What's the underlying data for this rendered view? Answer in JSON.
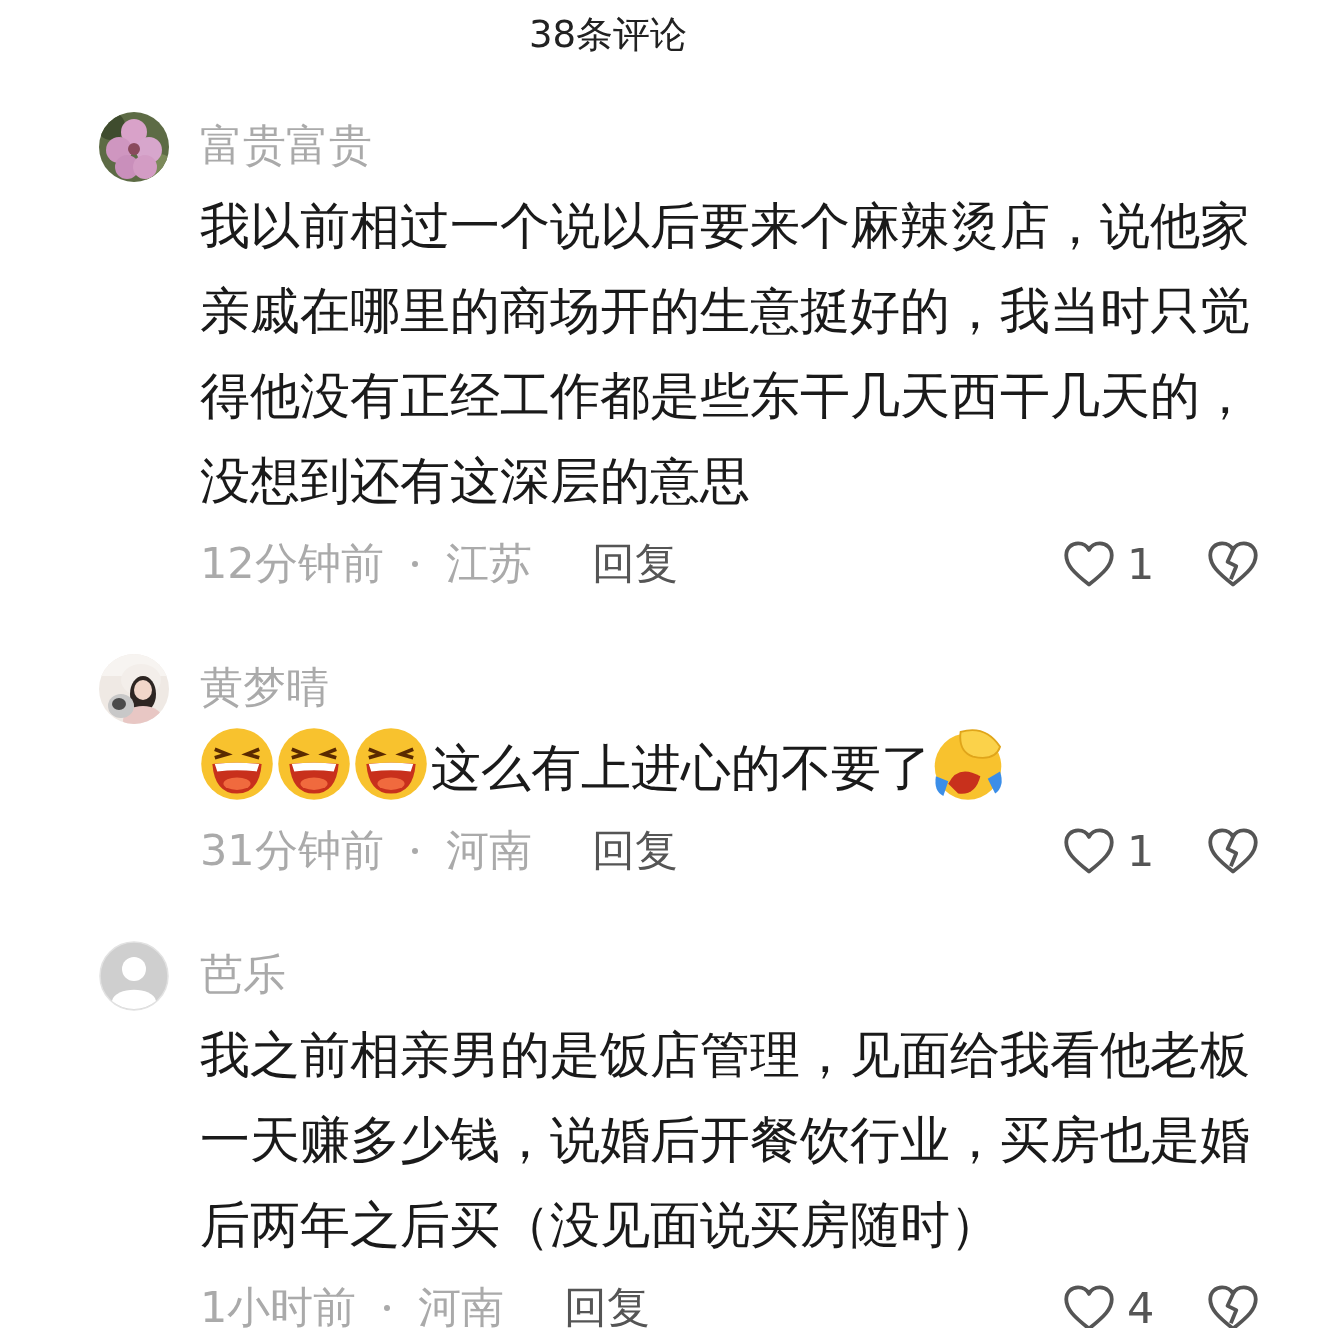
{
  "header": {
    "title": "38条评论"
  },
  "comments": [
    {
      "name": "富贵富贵",
      "content": [
        {
          "kind": "text",
          "text": "我以前相过一个说以后要来个麻辣烫店，说他家亲戚在哪里的商场开的生意挺好的，我当时只觉得他没有正经工作都是些东干几天西干几天的，没想到还有这深层的意思"
        }
      ],
      "time": "12分钟前",
      "location": "江苏",
      "reply": "回复",
      "likes": "1"
    },
    {
      "name": "黄梦晴",
      "content": [
        {
          "kind": "laughing"
        },
        {
          "kind": "laughing"
        },
        {
          "kind": "laughing"
        },
        {
          "kind": "text",
          "text": "这么有上进心的不要了"
        },
        {
          "kind": "facepalm"
        }
      ],
      "time": "31分钟前",
      "location": "河南",
      "reply": "回复",
      "likes": "1"
    },
    {
      "avatar": {
        "kind": "default"
      },
      "name": "芭乐",
      "content": [
        {
          "kind": "text",
          "text": "我之前相亲男的是饭店管理，见面给我看他老板一天赚多少钱，说婚后开餐饮行业，买房也是婚后两年之后买（没见面说买房随时）"
        }
      ],
      "time": "1小时前",
      "location": "河南",
      "reply": "回复",
      "likes": "4"
    }
  ]
}
